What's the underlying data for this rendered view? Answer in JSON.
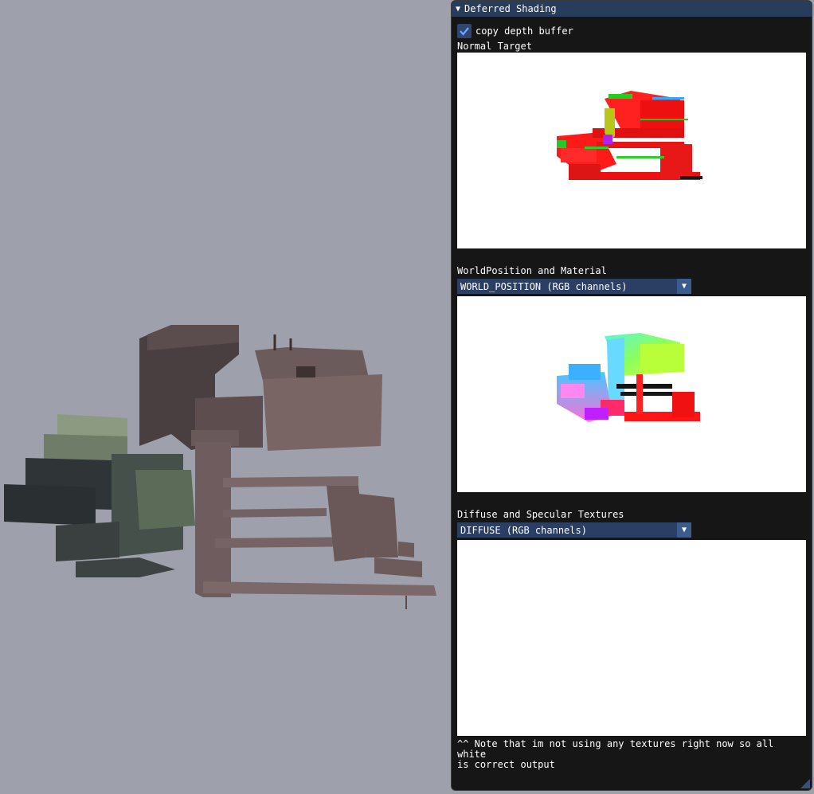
{
  "window": {
    "title": "Deferred Shading",
    "collapse_icon": "triangle-down-icon"
  },
  "controls": {
    "copy_depth_label": "copy depth buffer",
    "copy_depth_checked": true
  },
  "sections": {
    "normal_label": "Normal Target",
    "world_label": "WorldPosition and Material",
    "world_combo_value": "WORLD_POSITION (RGB channels)",
    "diffuse_label": "Diffuse and Specular Textures",
    "diffuse_combo_value": "DIFFUSE (RGB channels)",
    "note": "^^ Note that im not using any textures right now so all white\nis correct output"
  },
  "colors": {
    "viewport_bg": "#9ea1ab",
    "window_bg": "#161616",
    "titlebar": "#283c5c",
    "accent": "#3c5c8d"
  }
}
